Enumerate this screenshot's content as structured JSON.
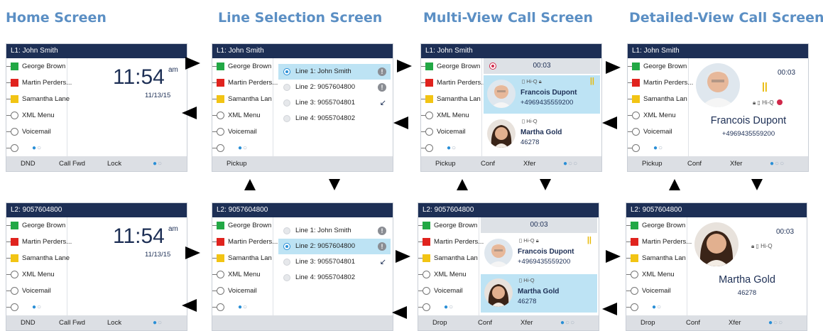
{
  "titles": {
    "home": "Home Screen",
    "line_selection": "Line Selection Screen",
    "multi_view": "Multi-View Call Screen",
    "detailed_view": "Detailed-View Call Screen"
  },
  "bars": {
    "l1": "L1: John Smith",
    "l2": "L2: 9057604800"
  },
  "keys": {
    "george": "George Brown",
    "martin": "Martin Perders...",
    "samantha_full": "Samantha Lane",
    "samantha_short": "Samantha Lan",
    "xml": "XML Menu",
    "voicemail": "Voicemail",
    "colors": {
      "green": "#22a845",
      "red": "#e0231e",
      "yellow": "#f2c414"
    }
  },
  "clock": {
    "time": "11:54",
    "ampm": "am",
    "date": "11/13/15"
  },
  "softkeys": {
    "dnd": "DND",
    "call_fwd": "Call Fwd",
    "lock": "Lock",
    "pickup": "Pickup",
    "conf": "Conf",
    "xfer": "Xfer",
    "drop": "Drop"
  },
  "page_dots": {
    "two": [
      "on",
      "off"
    ],
    "three": [
      "on",
      "off",
      "off"
    ]
  },
  "lines": [
    {
      "label": "Line 1: John Smith",
      "badge": "info"
    },
    {
      "label": "Line 2: 9057604800",
      "badge": "info"
    },
    {
      "label": "Line 3: 9055704801",
      "badge": "forward"
    },
    {
      "label": "Line 4: 9055704802",
      "badge": ""
    }
  ],
  "badges": {
    "info": "!",
    "forward": "↙"
  },
  "call": {
    "timer": "00:03",
    "status_rec": "Hi-Q",
    "status_lock_hiq": "Hi-Q",
    "pause": "||",
    "francois": {
      "name": "Francois Dupont",
      "number": "+4969435559200"
    },
    "martha": {
      "name": "Martha Gold",
      "number": "46278"
    }
  },
  "icons": {
    "lock": "lock-icon",
    "hiq": "hi-q-icon",
    "record": "record-icon",
    "pause": "pause-icon",
    "arrow_right": "arrow-right-icon",
    "arrow_left": "arrow-left-icon",
    "arrow_up": "arrow-up-icon",
    "arrow_down": "arrow-down-icon"
  }
}
